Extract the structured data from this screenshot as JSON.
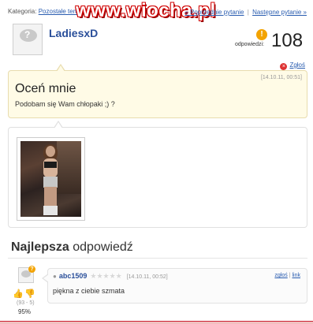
{
  "header": {
    "breadcrumb_prefix": "Kategoria:",
    "breadcrumb_link": "Pozostałe tematy",
    "watermark": "www.wiocha.pl",
    "prev_question": "« Poprzednie pytanie",
    "next_question": "Następne pytanie »"
  },
  "asker": {
    "username": "LadiesxD",
    "avatar_icon": "question-bubble-icon"
  },
  "answers": {
    "icon": "!",
    "label": "odpowiedzi:",
    "count": "108"
  },
  "report": {
    "label": "Zgłoś"
  },
  "question": {
    "timestamp": "[14.10.11, 00:51]",
    "title": "Oceń mnie",
    "text": "Podobam się Wam chłopaki ;) ?"
  },
  "best_answer": {
    "heading_bold": "Najlepsza",
    "heading_rest": " odpowiedź",
    "user": "abc1509",
    "stars": "★★★★★",
    "timestamp": "[14.10.11, 00:52]",
    "report_link": "zgłoś",
    "separator": "|",
    "link_label": "link",
    "text": "piękna z ciebie szmata",
    "votes": "(93 - 5)",
    "percent": "95%"
  },
  "colors": {
    "accent": "#2a4f9a",
    "link": "#2a5db0",
    "question_bg": "#fffbe6",
    "answer_badge": "#f3a300",
    "watermark_red": "#d00000"
  }
}
